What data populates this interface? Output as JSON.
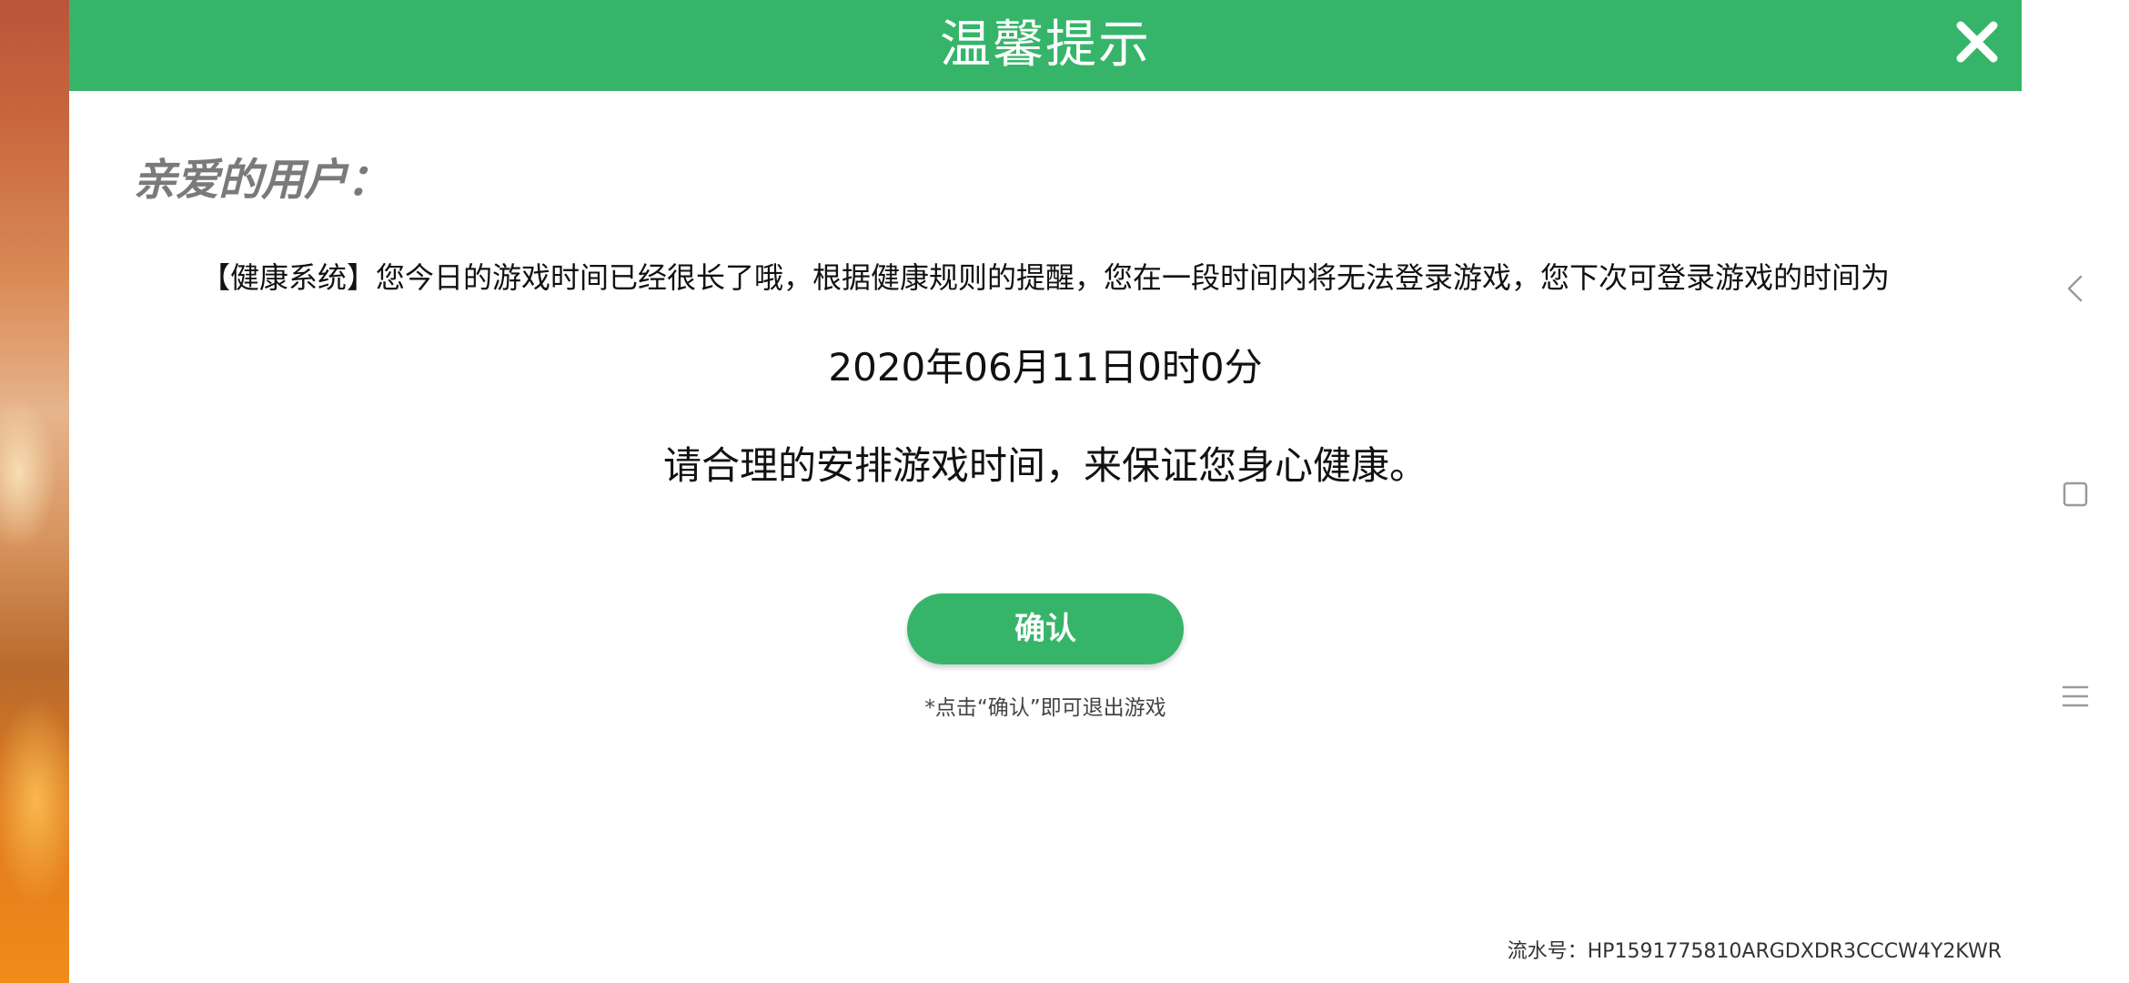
{
  "dialog": {
    "title": "温馨提示",
    "greeting": "亲爱的用户：",
    "notice": "【健康系统】您今日的游戏时间已经很长了哦，根据健康规则的提醒，您在一段时间内将无法登录游戏，您下次可登录游戏的时间为",
    "next_login_time": "2020年06月11日0时0分",
    "advice": "请合理的安排游戏时间，来保证您身心健康。",
    "confirm_label": "确认",
    "hint": "*点击“确认”即可退出游戏",
    "serial": "流水号：HP1591775810ARGDXDR3CCCW4Y2KWR"
  },
  "icons": {
    "close": "close-icon",
    "back": "back-nav-icon",
    "home": "home-nav-icon",
    "menu": "menu-nav-icon"
  },
  "colors": {
    "header_green": "#36b56a",
    "button_green": "#36b56a",
    "greeting_gray": "#7a7a7a"
  }
}
